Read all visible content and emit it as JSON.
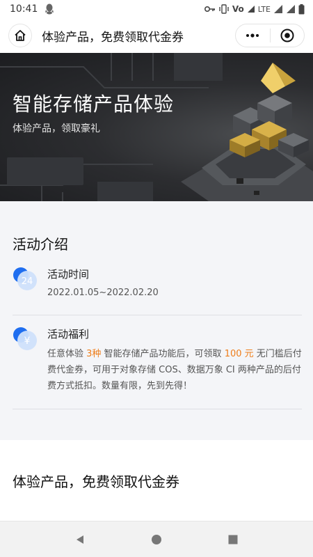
{
  "status_bar": {
    "time": "10:41",
    "network": "LTE",
    "volte": "Vo",
    "icons": [
      "qq-icon",
      "key-icon",
      "vibrate-icon",
      "volte-icon",
      "signal-icon",
      "battery-icon"
    ]
  },
  "title_bar": {
    "title": "体验产品，免费领取代金券",
    "icons": [
      "home-icon",
      "more-icon",
      "close-target-icon"
    ]
  },
  "hero": {
    "title": "智能存储产品体验",
    "subtitle": "体验产品，领取豪礼"
  },
  "intro": {
    "section_title": "活动介绍",
    "items": [
      {
        "icon": "calendar-24-icon",
        "icon_glyph": "24",
        "heading": "活动时间",
        "body": "2022.01.05~2022.02.20"
      },
      {
        "icon": "yuan-icon",
        "icon_glyph": "¥",
        "heading": "活动福利",
        "body_parts": {
          "p1": "任意体验 ",
          "h1": "3种",
          "p2": " 智能存储产品功能后，可领取 ",
          "h2": "100 元",
          "p3": " 无门槛后付费代金券，可用于对象存储 COS、数据万象 CI 两种产品的后付费方式抵扣。数量有限，先到先得！"
        }
      }
    ]
  },
  "experience": {
    "section_title": "体验产品，免费领取代金券"
  },
  "nav": {
    "icons": [
      "back-triangle-icon",
      "home-circle-icon",
      "recent-square-icon"
    ]
  },
  "colors": {
    "accent_blue": "#1f6ef0",
    "highlight_orange": "#ee7d1a",
    "section_bg": "#f4f5f8",
    "hero_bg": "#2c2d30"
  }
}
